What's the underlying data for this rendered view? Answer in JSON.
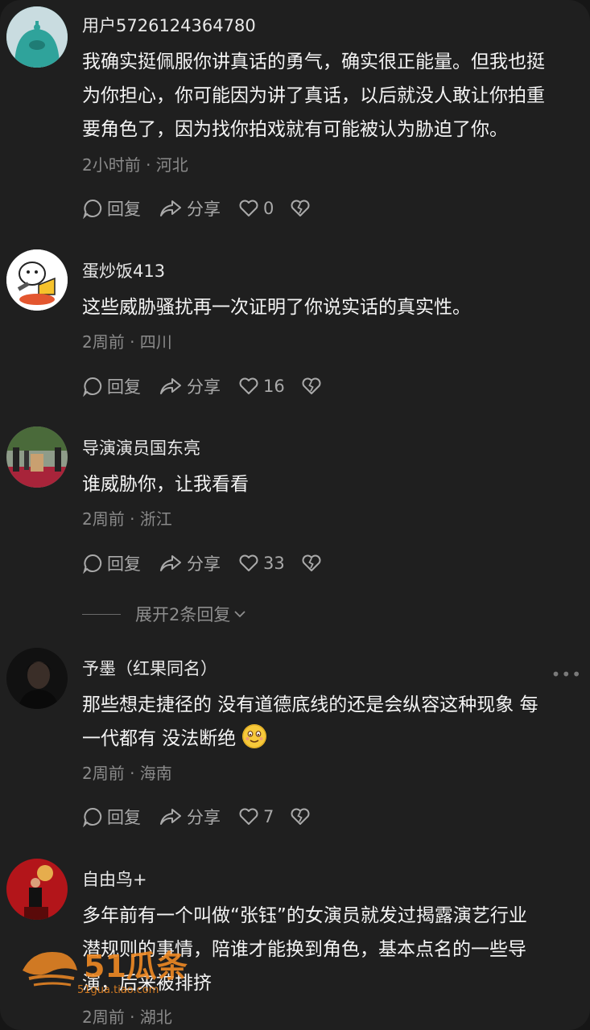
{
  "comments": [
    {
      "username": "用户5726124364780",
      "text_lines": [
        "我确实挺佩服你讲真话的勇气，确实很正能量。但我也挺",
        "为你担心，你可能因为讲了真话，以后就没人敢让你拍重",
        "要角色了，因为找你拍戏就有可能被认为胁迫了你。"
      ],
      "meta": "2小时前 · 河北",
      "reply_label": "回复",
      "share_label": "分享",
      "like_count": "0",
      "avatar_color": "#38a9a3"
    },
    {
      "username": "蛋炒饭413",
      "text_lines": [
        "这些威胁骚扰再一次证明了你说实话的真实性。"
      ],
      "meta": "2周前 · 四川",
      "reply_label": "回复",
      "share_label": "分享",
      "like_count": "16",
      "avatar_color": "#ffffff"
    },
    {
      "username": "导演演员国东亮",
      "text_lines": [
        "谁威胁你，让我看看"
      ],
      "meta": "2周前 · 浙江",
      "reply_label": "回复",
      "share_label": "分享",
      "like_count": "33",
      "avatar_color": "#7a6a5a"
    },
    {
      "username": "予墨（红果同名）",
      "text_line1": "那些想走捷径的 没有道德底线的还是会纵容这种现象 每",
      "text_line2": "一代都有 没法断绝",
      "meta": "2周前 · 海南",
      "reply_label": "回复",
      "share_label": "分享",
      "like_count": "7",
      "avatar_color": "#1a1a1a"
    },
    {
      "username": "自由鸟+",
      "text_lines": [
        "多年前有一个叫做“张钰”的女演员就发过揭露演艺行业",
        "潜规则的事情，陪谁才能换到角色，基本点名的一些导",
        "演，后来被排挤"
      ],
      "meta": "2周前 · 湖北",
      "avatar_color": "#b5201a"
    }
  ],
  "expand_replies": "展开2条回复",
  "watermark": {
    "brand": "51瓜条",
    "site": "51gua.tiao.com"
  },
  "icons": [
    "comment-bubble-icon",
    "share-arrow-icon",
    "heart-icon",
    "broken-heart-icon",
    "more-dots-icon",
    "chevron-down-icon",
    "smile-emoji-icon"
  ],
  "colors": {
    "background": "#1f1f1f",
    "text": "#f4f4f4",
    "meta": "#8a8a8a",
    "watermark": "#f08a24"
  }
}
